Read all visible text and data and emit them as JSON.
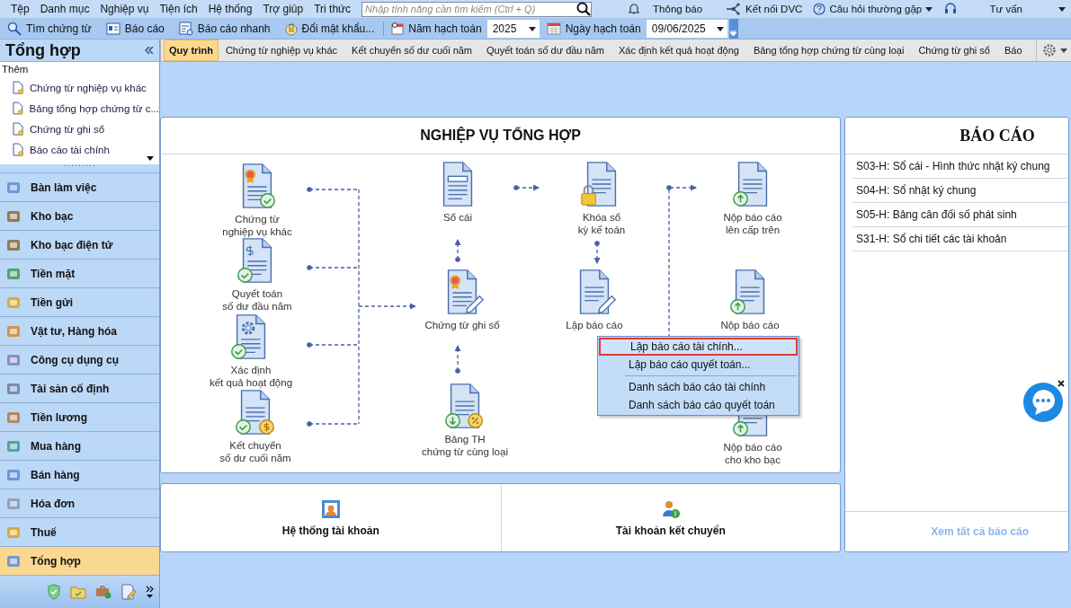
{
  "menu_bar": {
    "items": [
      "Tệp",
      "Danh mục",
      "Nghiệp vụ",
      "Tiện ích",
      "Hệ thống",
      "Trợ giúp",
      "Tri thức"
    ],
    "search": {
      "placeholder": "Nhập tính năng cần tìm kiếm (Ctrl + Q)"
    },
    "links": [
      "Thông báo",
      "Kết nối DVC",
      "Câu hỏi thường gặp",
      "Tư vấn"
    ]
  },
  "toolbar": {
    "buttons": [
      "Tìm chứng từ",
      "Báo cáo",
      "Báo cáo nhanh",
      "Đổi mật khẩu..."
    ],
    "year_label": "Năm hạch toán",
    "year": "2025",
    "date_label": "Ngày hạch toán",
    "date": "09/06/2025"
  },
  "sidebar": {
    "title": "Tổng hợp",
    "more_label": "Thêm",
    "shortcuts": [
      "Chứng từ nghiệp vụ khác",
      "Bảng tổng hợp chứng từ c...",
      "Chứng từ ghi sổ",
      "Báo cáo tài chính"
    ],
    "modules": [
      {
        "label": "Bàn làm việc",
        "selected": false
      },
      {
        "label": "Kho bạc",
        "selected": false
      },
      {
        "label": "Kho bạc điện tử",
        "selected": false
      },
      {
        "label": "Tiền mặt",
        "selected": false
      },
      {
        "label": "Tiền gửi",
        "selected": false
      },
      {
        "label": "Vật tư, Hàng hóa",
        "selected": false
      },
      {
        "label": "Công cụ dụng cụ",
        "selected": false
      },
      {
        "label": "Tài sản cố định",
        "selected": false
      },
      {
        "label": "Tiền lương",
        "selected": false
      },
      {
        "label": "Mua hàng",
        "selected": false
      },
      {
        "label": "Bán hàng",
        "selected": false
      },
      {
        "label": "Hóa đơn",
        "selected": false
      },
      {
        "label": "Thuế",
        "selected": false
      },
      {
        "label": "Tổng hợp",
        "selected": true
      }
    ]
  },
  "tabs": [
    {
      "label": "Quy trình",
      "selected": true
    },
    {
      "label": "Chứng từ nghiệp vụ khác",
      "selected": false
    },
    {
      "label": "Kết chuyển số dư cuối năm",
      "selected": false
    },
    {
      "label": "Quyết toán số dư đầu năm",
      "selected": false
    },
    {
      "label": "Xác định kết quả hoạt động",
      "selected": false
    },
    {
      "label": "Bảng tổng hợp chứng từ cùng loại",
      "selected": false
    },
    {
      "label": "Chứng từ ghi sổ",
      "selected": false
    },
    {
      "label": "Báo",
      "selected": false
    }
  ],
  "workflow": {
    "title": "NGHIỆP VỤ TỔNG HỢP",
    "nodes": [
      {
        "lines": [
          "Chứng từ",
          "nghiệp vụ khác"
        ]
      },
      {
        "lines": [
          "Quyết toán",
          "số dư đầu năm"
        ]
      },
      {
        "lines": [
          "Xác định",
          "kết quả hoạt động"
        ]
      },
      {
        "lines": [
          "Kết chuyển",
          "số dư cuối năm"
        ]
      },
      {
        "lines": [
          "Sổ cái"
        ]
      },
      {
        "lines": [
          "Chứng từ ghi sổ"
        ]
      },
      {
        "lines": [
          "Bảng TH",
          "chứng từ cùng loại"
        ]
      },
      {
        "lines": [
          "Khóa sổ",
          "kỳ kế toán"
        ]
      },
      {
        "lines": [
          "Lập báo cáo"
        ]
      },
      {
        "lines": [
          "Nộp báo cáo",
          "lên cấp trên"
        ]
      },
      {
        "lines": [
          "Nộp báo cáo"
        ]
      },
      {
        "lines": [
          "Nộp báo cáo",
          "cho kho bạc"
        ]
      }
    ],
    "context_menu": [
      {
        "label": "Lập báo cáo tài chính...",
        "selected": true
      },
      {
        "label": "Lập báo cáo quyết toán...",
        "selected": false
      },
      {
        "label": "Danh sách báo cáo tài chính",
        "selected": false
      },
      {
        "label": "Danh sách báo cáo quyết toán",
        "selected": false
      }
    ]
  },
  "reports": {
    "title": "BÁO CÁO",
    "items": [
      "S03-H: Sổ cái - Hình thức nhật ký chung",
      "S04-H: Sổ nhật ký chung",
      "S05-H: Bảng cân đối số phát sinh",
      "S31-H: Sổ chi tiết các tài khoản"
    ],
    "view_all": "Xem tất cả báo cáo"
  },
  "quick_links": [
    "Hệ thống tài khoản",
    "Tài khoản kết chuyển"
  ]
}
